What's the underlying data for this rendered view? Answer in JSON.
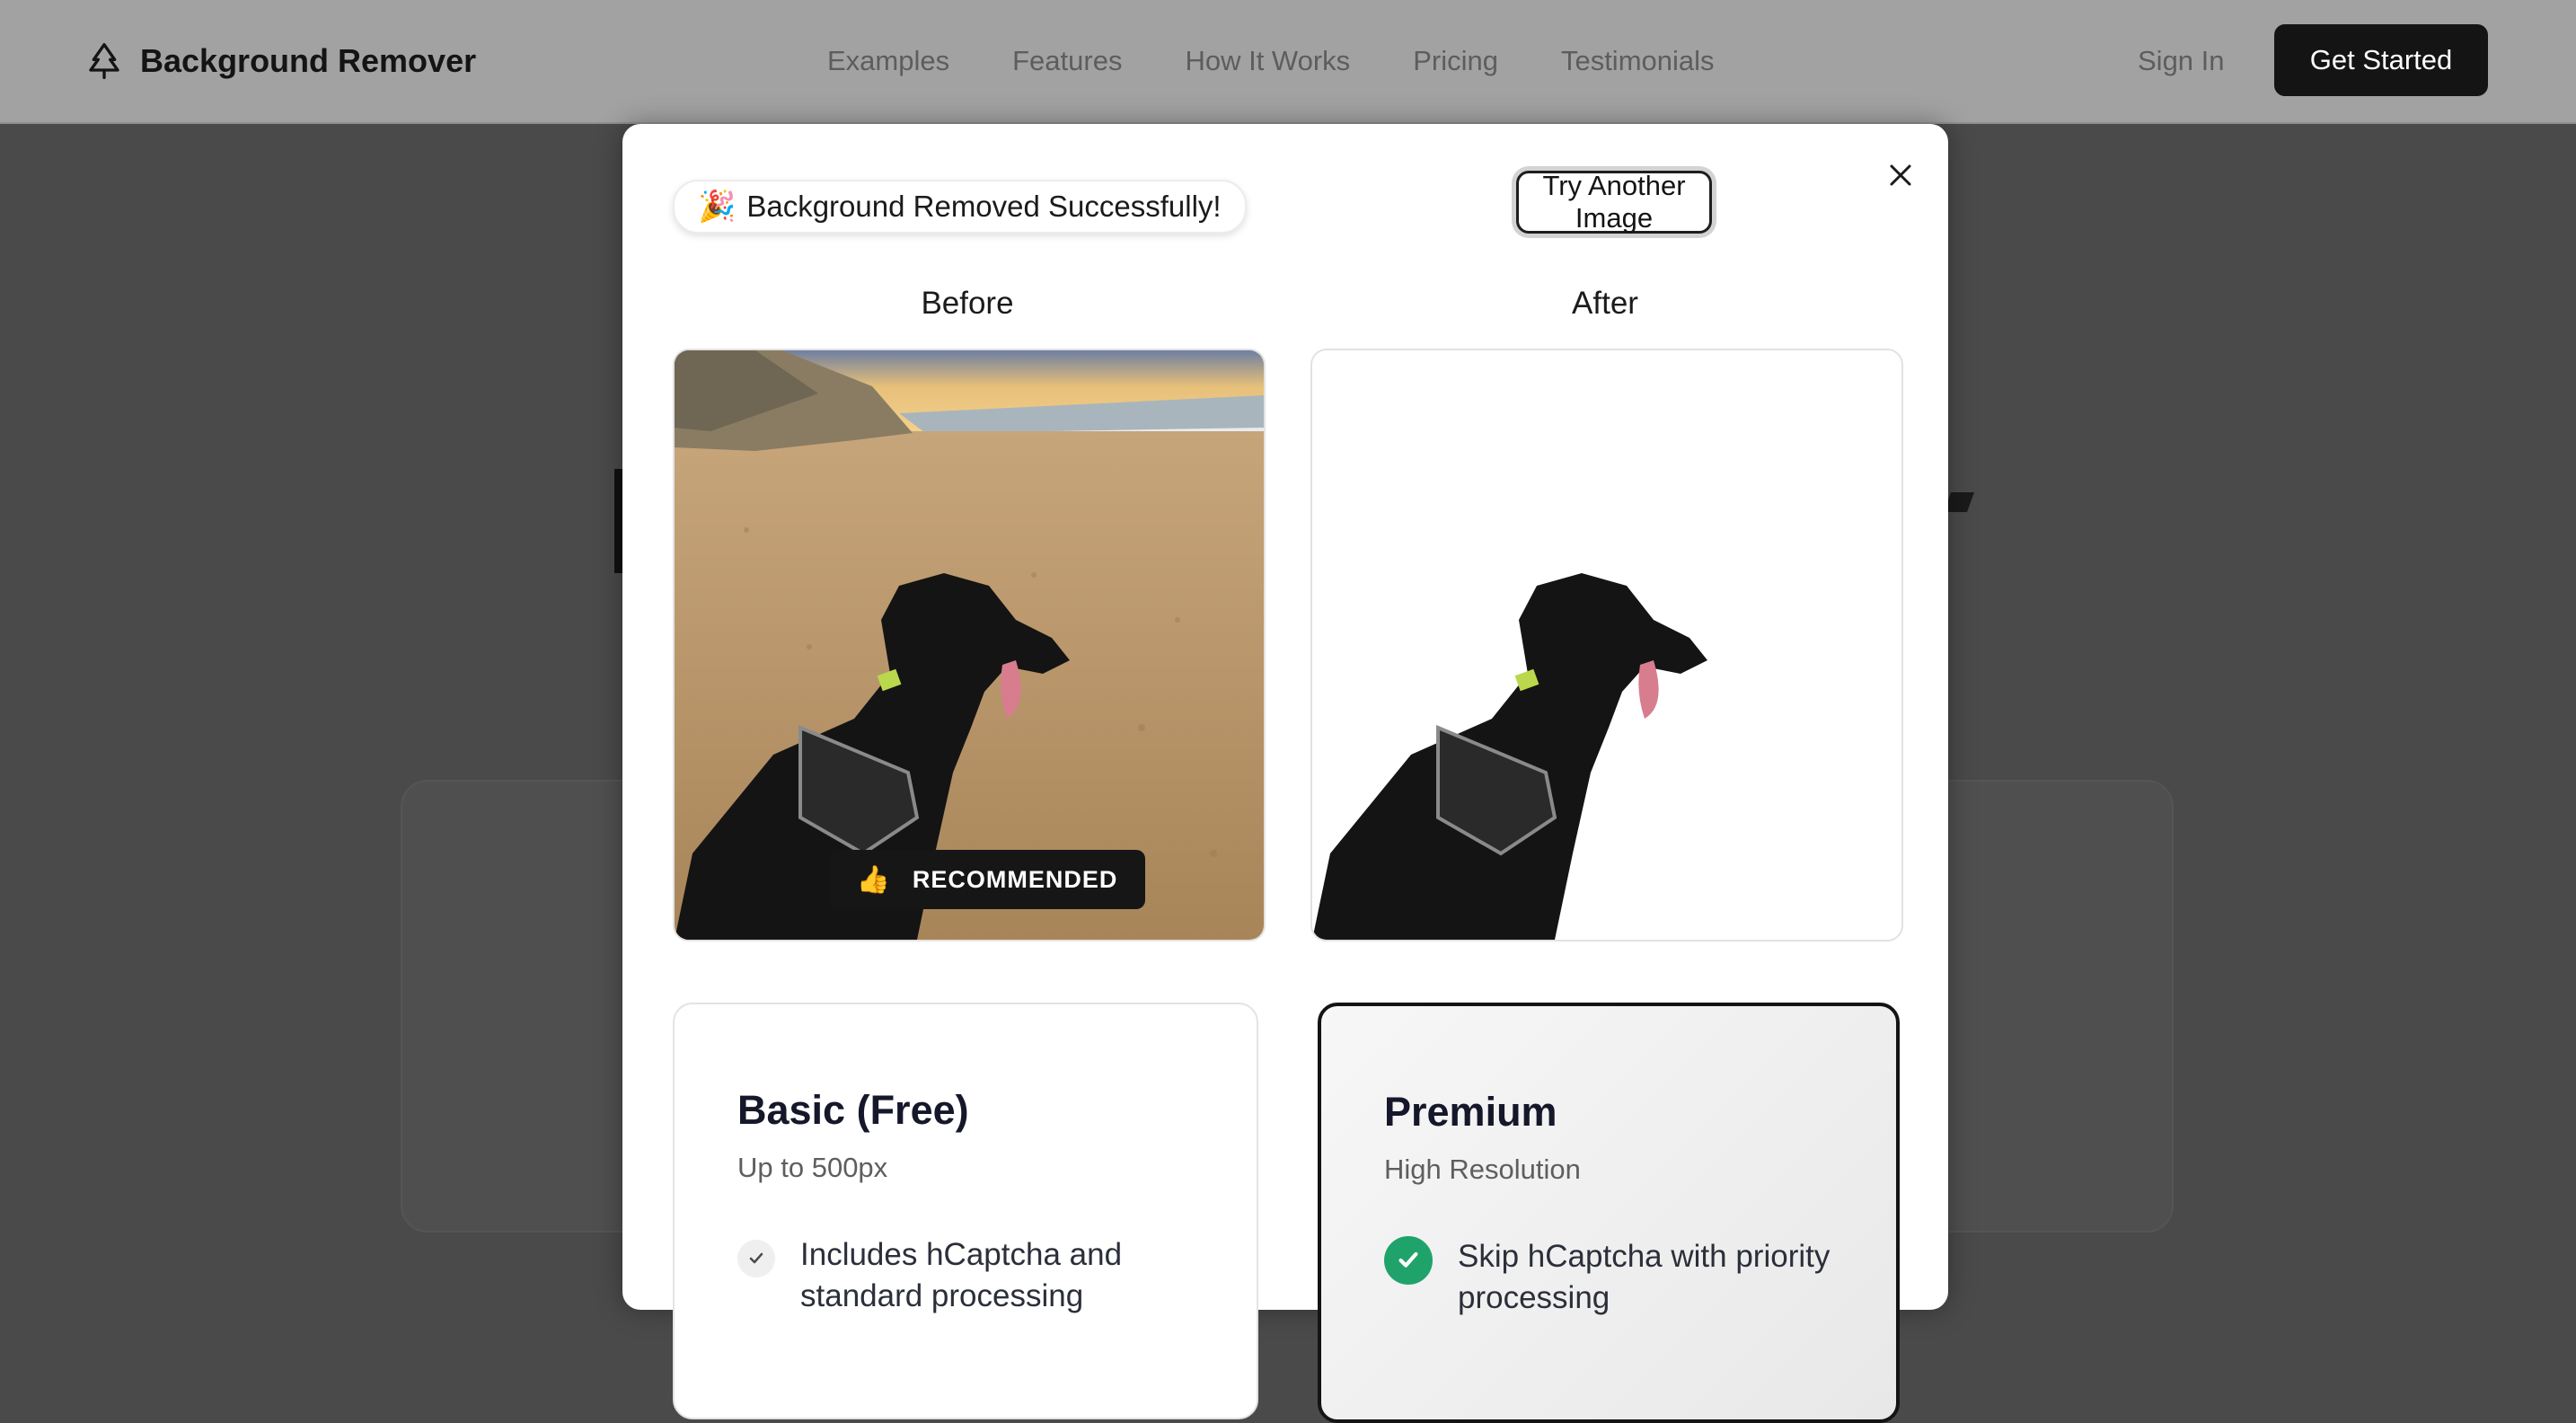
{
  "nav": {
    "brand": "Background Remover",
    "links": [
      "Examples",
      "Features",
      "How It Works",
      "Pricing",
      "Testimonials"
    ],
    "sign_in": "Sign In",
    "cta": "Get Started"
  },
  "modal": {
    "status": "Background Removed Successfully!",
    "status_emoji": "🎉",
    "try_again": "Try Another Image",
    "before_label": "Before",
    "after_label": "After"
  },
  "plans": {
    "badge": "RECOMMENDED",
    "badge_emoji": "👍",
    "basic": {
      "title": "Basic (Free)",
      "subtitle": "Up to 500px",
      "feature": "Includes hCaptcha and standard processing"
    },
    "premium": {
      "title": "Premium",
      "subtitle": "High Resolution",
      "feature": "Skip hCaptcha with priority processing"
    }
  },
  "icons": {
    "brand": "tree-icon",
    "close": "close-icon",
    "check": "check-icon"
  },
  "colors": {
    "accent": "#141414",
    "success": "#20a36a",
    "overlay": "#4a4a4a"
  }
}
